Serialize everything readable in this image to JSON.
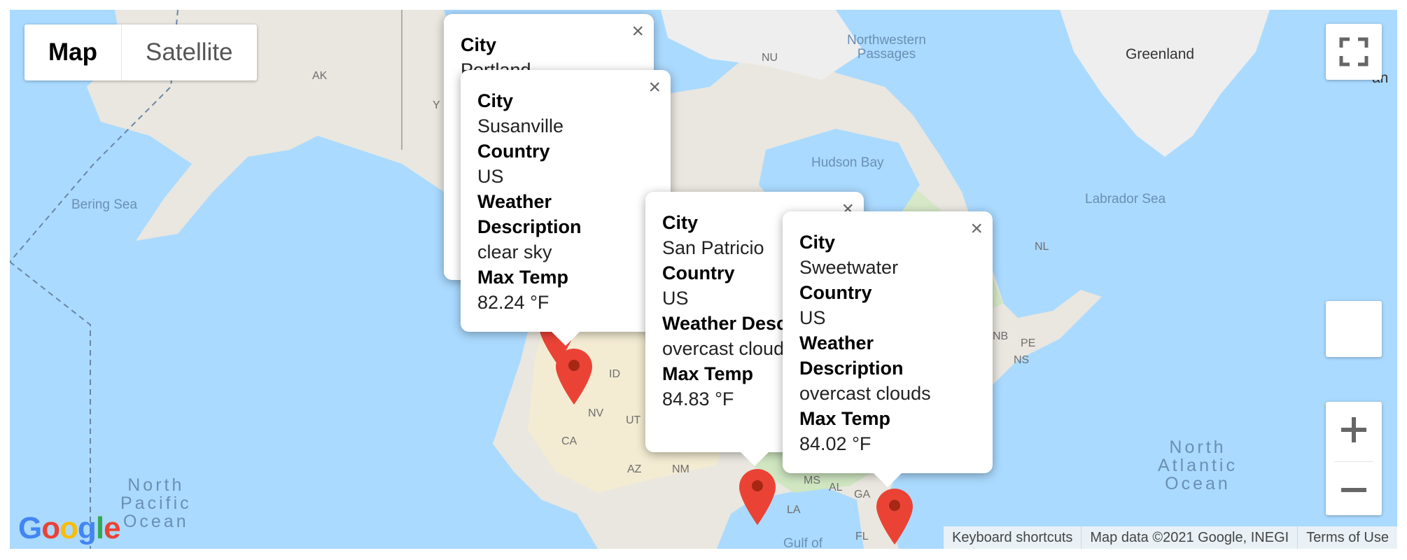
{
  "map_type": {
    "map": "Map",
    "satellite": "Satellite"
  },
  "labels": {
    "greenland": "Greenland",
    "northwestern_passages": "Northwestern\nPassages",
    "hudson_bay": "Hudson Bay",
    "labrador_sea": "Labrador Sea",
    "bering_sea": "Bering Sea",
    "north_pacific": "North\nPacific\nOcean",
    "north_atlantic": "North\nAtlantic\nOcean",
    "gulf": "Gulf of",
    "ak": "AK",
    "nu": "NU",
    "yt": "Y",
    "nl": "NL",
    "nb": "NB",
    "pe": "PE",
    "ns": "NS",
    "id": "ID",
    "nv": "NV",
    "ut": "UT",
    "ca": "CA",
    "az": "AZ",
    "nm": "NM",
    "ms": "MS",
    "al": "AL",
    "ga": "GA",
    "la": "LA",
    "fl": "FL",
    "an": "an"
  },
  "infowindows": {
    "portland": {
      "city_label": "City",
      "city": "Portland"
    },
    "susanville": {
      "city_label": "City",
      "city": "Susanville",
      "country_label": "Country",
      "country": "US",
      "desc_label": "Weather Description",
      "desc": "clear sky",
      "temp_label": "Max Temp",
      "temp": "82.24 °F"
    },
    "sanpatricio": {
      "city_label": "City",
      "city": "San Patricio",
      "country_label": "Country",
      "country": "US",
      "desc_label": "Weather Description",
      "desc": "overcast clouds",
      "temp_label": "Max Temp",
      "temp": "84.83 °F"
    },
    "sweetwater": {
      "city_label": "City",
      "city": "Sweetwater",
      "country_label": "Country",
      "country": "US",
      "desc_label": "Weather Description",
      "desc": "overcast clouds",
      "temp_label": "Max Temp",
      "temp": "84.02 °F"
    }
  },
  "footer": {
    "shortcuts": "Keyboard shortcuts",
    "data": "Map data ©2021 Google, INEGI",
    "terms": "Terms of Use"
  },
  "close_glyph": "×",
  "colors": {
    "water": "#aadaff",
    "land": "#e8e8e0",
    "green": "#cfe6c1",
    "desert": "#f1ead0",
    "marker": "#ea4335",
    "marker_dot": "#a52714"
  }
}
